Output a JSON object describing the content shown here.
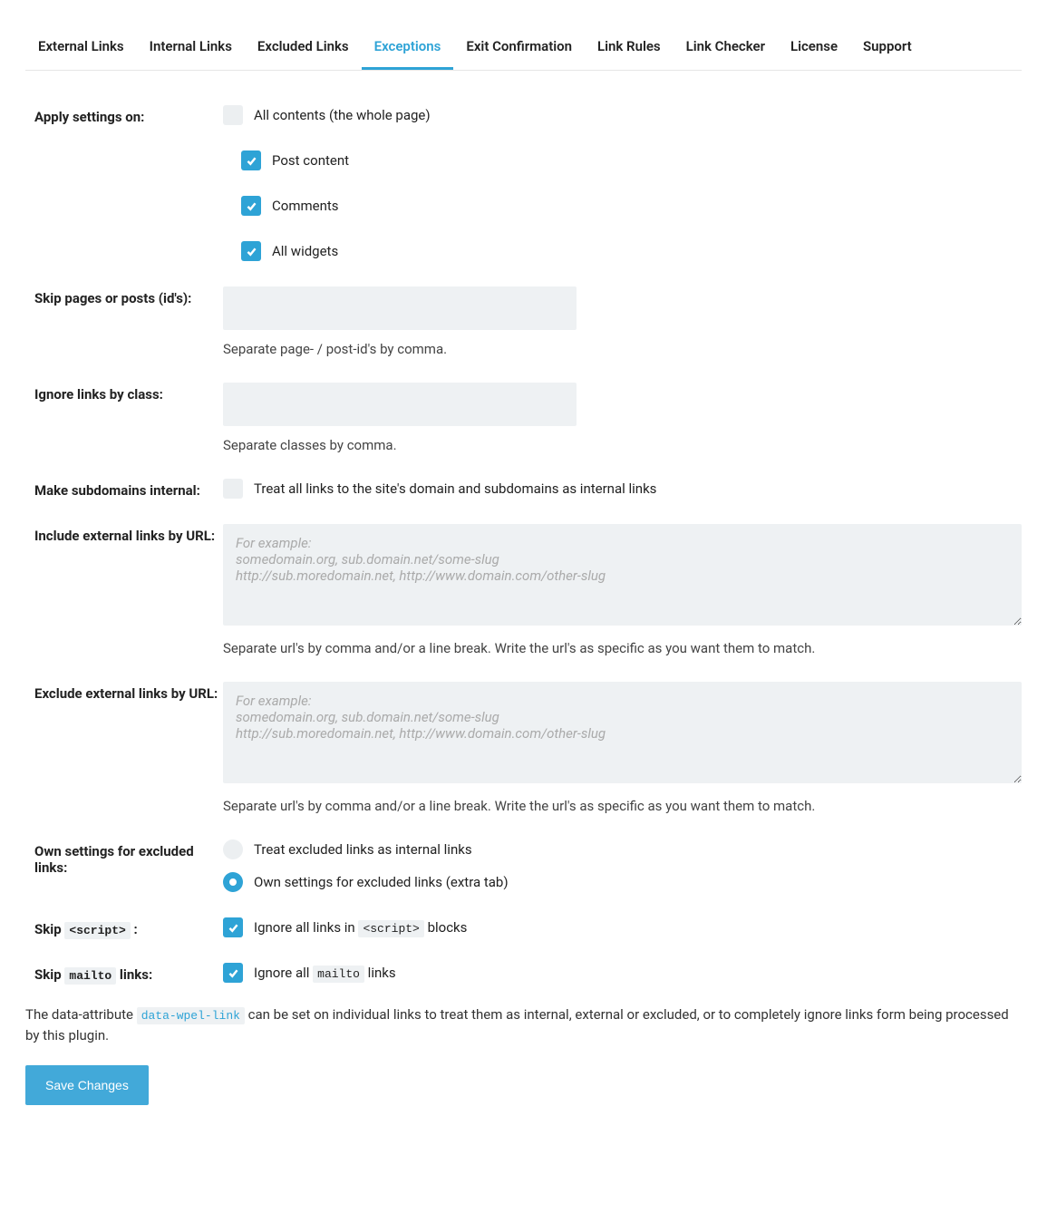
{
  "tabs": [
    {
      "label": "External Links",
      "active": false
    },
    {
      "label": "Internal Links",
      "active": false
    },
    {
      "label": "Excluded Links",
      "active": false
    },
    {
      "label": "Exceptions",
      "active": true
    },
    {
      "label": "Exit Confirmation",
      "active": false
    },
    {
      "label": "Link Rules",
      "active": false
    },
    {
      "label": "Link Checker",
      "active": false
    },
    {
      "label": "License",
      "active": false
    },
    {
      "label": "Support",
      "active": false
    }
  ],
  "apply_settings": {
    "label": "Apply settings on:",
    "all_contents": {
      "label": "All contents (the whole page)",
      "checked": false
    },
    "post_content": {
      "label": "Post content",
      "checked": true
    },
    "comments": {
      "label": "Comments",
      "checked": true
    },
    "all_widgets": {
      "label": "All widgets",
      "checked": true
    }
  },
  "skip_pages": {
    "label": "Skip pages or posts (id's):",
    "value": "",
    "help": "Separate page- / post-id's by comma."
  },
  "ignore_class": {
    "label": "Ignore links by class:",
    "value": "",
    "help": "Separate classes by comma."
  },
  "subdomains": {
    "label": "Make subdomains internal:",
    "checkbox_label": "Treat all links to the site's domain and subdomains as internal links",
    "checked": false
  },
  "include_external": {
    "label": "Include external links by URL:",
    "value": "",
    "placeholder": "For example:\nsomedomain.org, sub.domain.net/some-slug\nhttp://sub.moredomain.net, http://www.domain.com/other-slug",
    "help": "Separate url's by comma and/or a line break. Write the url's as specific as you want them to match."
  },
  "exclude_external": {
    "label": "Exclude external links by URL:",
    "value": "",
    "placeholder": "For example:\nsomedomain.org, sub.domain.net/some-slug\nhttp://sub.moredomain.net, http://www.domain.com/other-slug",
    "help": "Separate url's by comma and/or a line break. Write the url's as specific as you want them to match."
  },
  "own_settings": {
    "label": "Own settings for excluded links:",
    "opt_internal": "Treat excluded links as internal links",
    "opt_own": "Own settings for excluded links (extra tab)",
    "selected": "own"
  },
  "skip_script": {
    "label_prefix": "Skip ",
    "label_code": "<script>",
    "label_suffix": " :",
    "cb_prefix": "Ignore all links in ",
    "cb_code": "<script>",
    "cb_suffix": " blocks",
    "checked": true
  },
  "skip_mailto": {
    "label_prefix": "Skip ",
    "label_code": "mailto",
    "label_suffix": " links:",
    "cb_prefix": "Ignore all ",
    "cb_code": "mailto",
    "cb_suffix": " links",
    "checked": true
  },
  "footnote": {
    "prefix": "The data-attribute ",
    "code": "data-wpel-link",
    "suffix": " can be set on individual links to treat them as internal, external or excluded, or to completely ignore links form being processed by this plugin."
  },
  "save_button": "Save Changes"
}
